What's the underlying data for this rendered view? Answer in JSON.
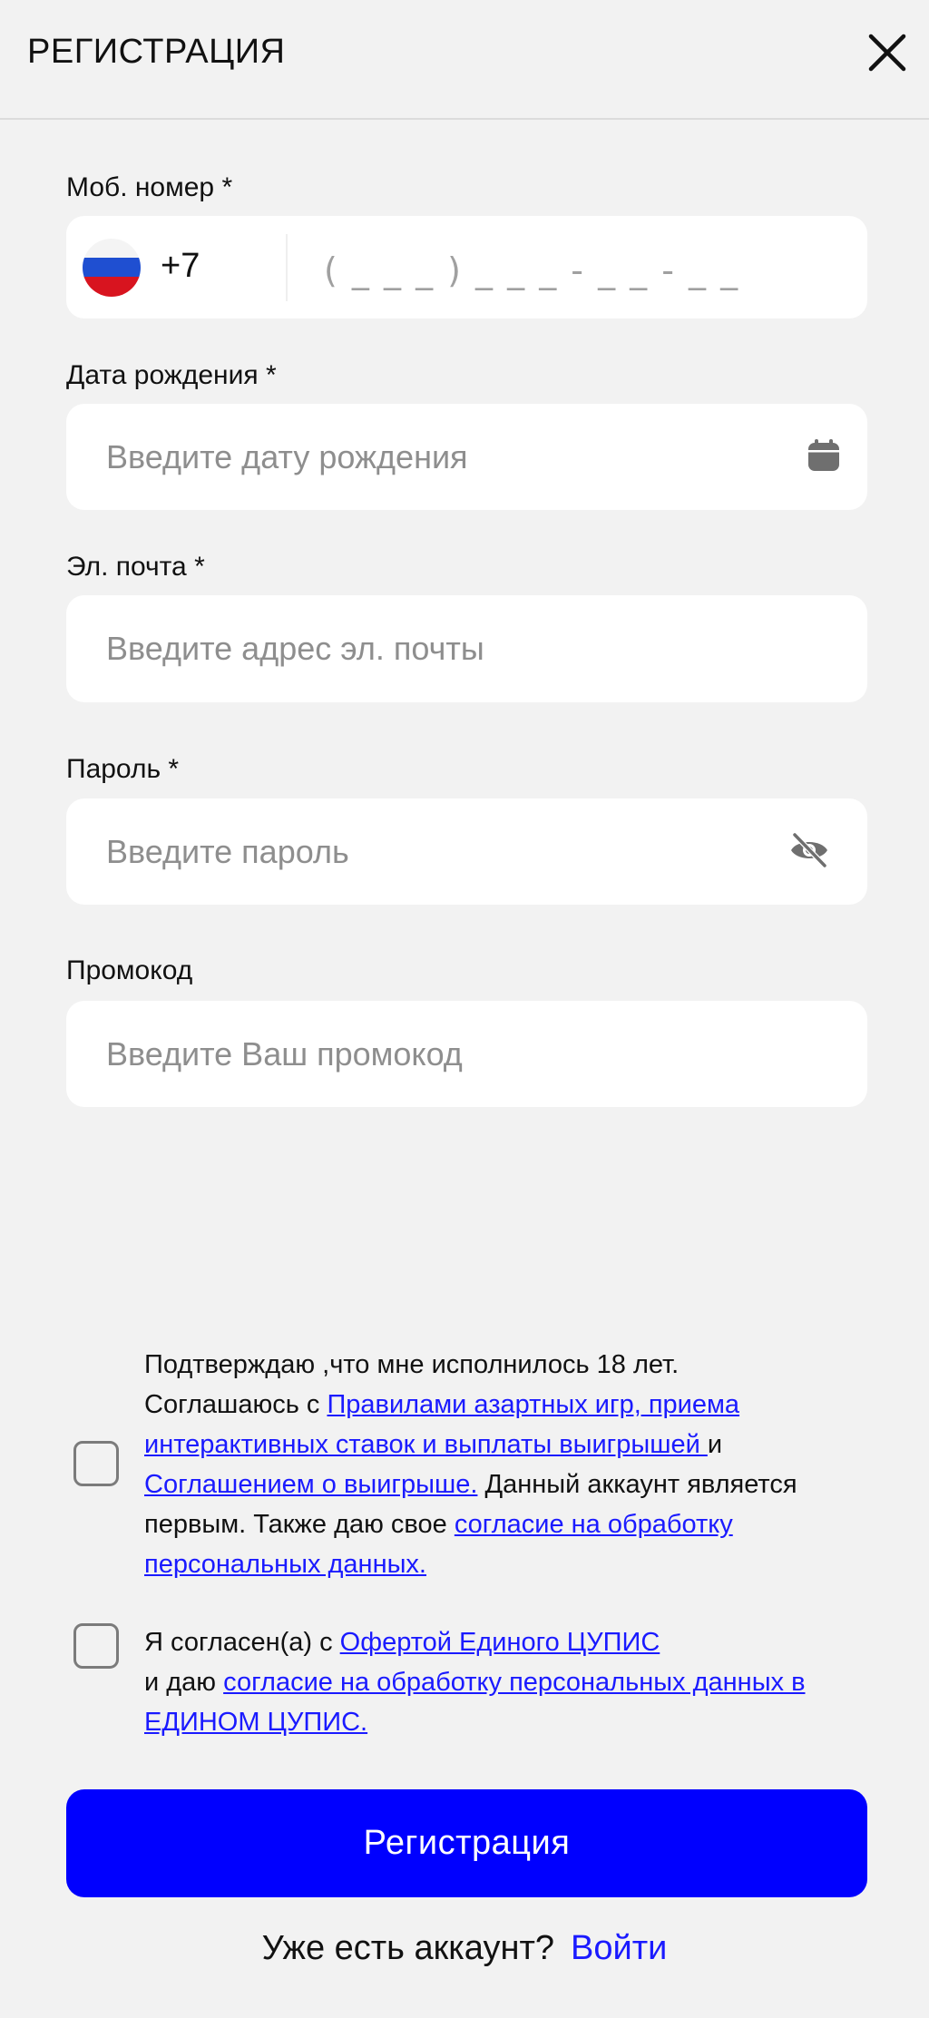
{
  "header": {
    "title": "РЕГИСТРАЦИЯ",
    "close_icon": "close-icon"
  },
  "form": {
    "phone": {
      "label": "Моб. номер *",
      "country_flag": "russia-flag-icon",
      "country_code": "+7",
      "mask": "( _ _ _ ) _ _ _ - _ _ - _ _",
      "value": ""
    },
    "birthdate": {
      "label": "Дата рождения *",
      "placeholder": "Введите дату рождения",
      "icon": "calendar-icon"
    },
    "email": {
      "label": "Эл. почта *",
      "placeholder": "Введите адрес эл. почты"
    },
    "password": {
      "label": "Пароль *",
      "placeholder": "Введите пароль",
      "icon": "eye-off-icon"
    },
    "promo": {
      "label": "Промокод",
      "placeholder": "Введите Ваш промокод"
    }
  },
  "agreements": {
    "age": {
      "checked": false,
      "line1": "Подтверждаю ,что мне исполнилось 18 лет.",
      "text2": "Соглашаюсь с ",
      "link1": "Правилами азартных игр, приема интерактивных ставок и выплаты выигрышей ",
      "text3": "и ",
      "link2": "Соглашением о выигрыше.",
      "text4": " Данный аккаунт является первым. Также даю свое ",
      "link3": "согласие на обработку персональных данных."
    },
    "cupis": {
      "checked": false,
      "text1": "Я согласен(а) с ",
      "link1": "Офертой Единого ЦУПИС",
      "text2": "и даю ",
      "link2": "согласие на обработку персональных данных в ЕДИНОМ ЦУПИС."
    }
  },
  "submit_label": "Регистрация",
  "footer": {
    "question": "Уже есть аккаунт?",
    "login_label": "Войти"
  },
  "colors": {
    "background": "#f2f2f2",
    "field": "#ffffff",
    "primary": "#0000ff",
    "link": "#1a1aff"
  }
}
